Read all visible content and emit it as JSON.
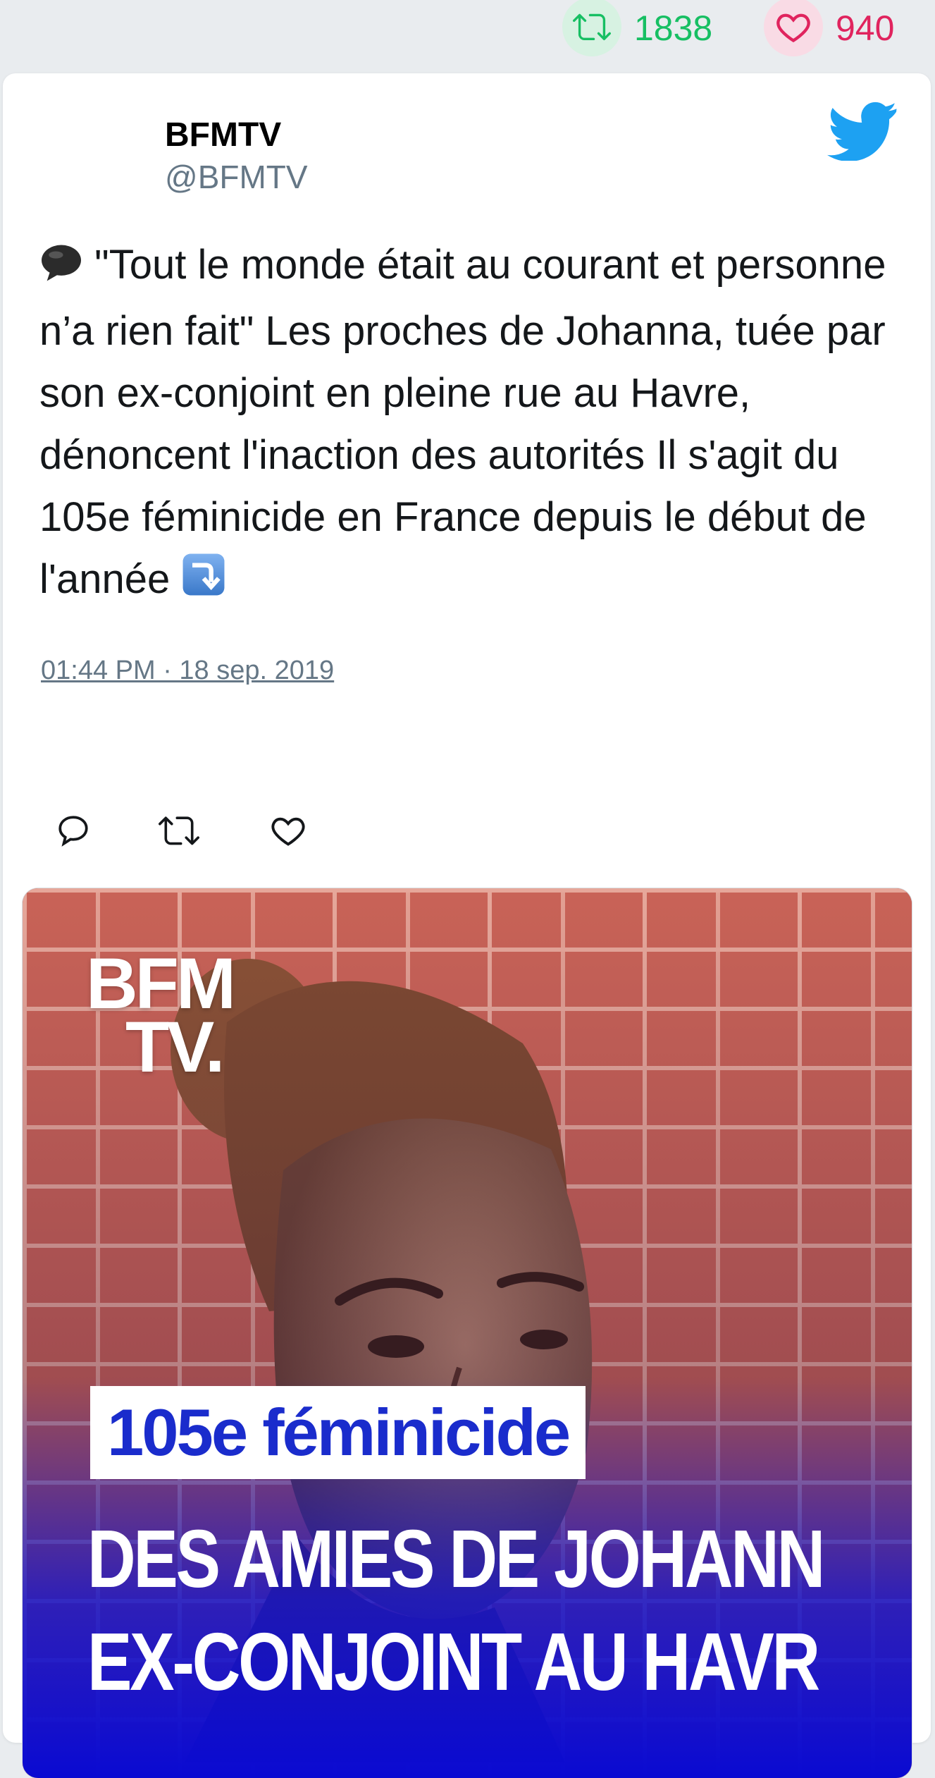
{
  "stats": {
    "retweets": "1838",
    "likes": "940",
    "retweet_color": "#17bf63",
    "like_color": "#e0245e"
  },
  "author": {
    "name": "BFMTV",
    "handle": "@BFMTV"
  },
  "tweet": {
    "text_emoji_lead": "🗨",
    "text": "\"Tout le monde était au courant et personne n’a rien fait\" Les proches de Johanna, tuée par son ex-conjoint en pleine rue au Havre, dénoncent l'inaction des autorités Il s'agit du 105e féminicide en France depuis le début de l'année",
    "text_emoji_trail": "⤵️",
    "timestamp": "01:44 PM · 18 sep. 2019"
  },
  "actions": {
    "reply_icon": "reply-icon",
    "retweet_icon": "retweet-icon",
    "like_icon": "heart-icon"
  },
  "media": {
    "logo_line1": "BFM",
    "logo_line2": "TV.",
    "headline": "105e féminicide",
    "caption_line1": "DES AMIES DE JOHANN",
    "caption_line2": "EX-CONJOINT AU HAVR"
  }
}
